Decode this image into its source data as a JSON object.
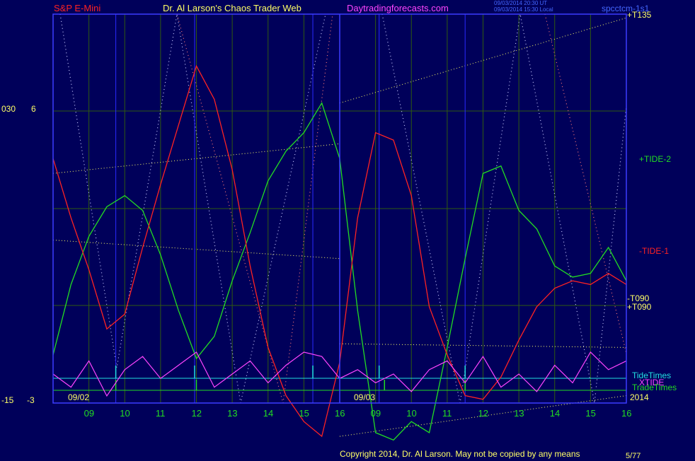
{
  "header": {
    "symbol": "S&P E-Mini",
    "title": "Dr. Al Larson's Chaos Trader Web",
    "site": "Daytradingforecasts.com",
    "time_line1": "09/03/2014 20:30 UT",
    "time_line2": "09/03/2014 15:30 Local",
    "file": "spcctcm-1s1"
  },
  "left_axis": {
    "top_a": "030",
    "top_b": "6",
    "bottom_a": "-15",
    "bottom_b": "-3"
  },
  "dates": {
    "day1": "09/02",
    "day2": "09/03",
    "year": "2014"
  },
  "copyright": "Copyright 2014, Dr. Al Larson. May not be copied by any means",
  "corner_code": "5/77",
  "colors": {
    "background": "#00005a",
    "frame": "#3c3cff",
    "grid": "#2f5a10",
    "tide2": "#22dd22",
    "tide1": "#ff2222",
    "xtide": "#ff44ff",
    "tide_times": "#22e0e0",
    "trade_times": "#22dd22",
    "yellow": "#ffff66",
    "pink": "#ff44ff",
    "blue_text": "#4466ff"
  },
  "chart_data": {
    "type": "line",
    "title": "Dr. Al Larson's Chaos Trader Web",
    "instrument": "S&P E-Mini",
    "x_ticks": [
      "09",
      "10",
      "11",
      "12",
      "13",
      "14",
      "15",
      "16",
      "09",
      "10",
      "11",
      "12",
      "13",
      "14",
      "15",
      "16"
    ],
    "x": [
      8.0,
      8.5,
      9.0,
      9.5,
      10.0,
      10.5,
      11.0,
      11.5,
      12.0,
      12.5,
      13.0,
      13.5,
      14.0,
      14.5,
      15.0,
      15.5,
      16.0,
      16.5,
      17.0,
      17.5,
      18.0,
      18.5,
      19.0,
      19.5,
      20.0,
      20.5,
      21.0,
      21.5,
      22.0,
      22.5,
      23.0,
      23.5,
      24.0
    ],
    "series": [
      {
        "name": "+TIDE-2",
        "values": [
          -1.7,
          0.2,
          1.5,
          2.3,
          2.6,
          2.2,
          1.0,
          -0.5,
          -1.8,
          -1.2,
          0.3,
          1.6,
          3.0,
          3.8,
          4.3,
          5.1,
          3.6,
          -0.5,
          -3.8,
          -4.0,
          -3.5,
          -3.8,
          -1.5,
          0.9,
          3.2,
          3.4,
          2.2,
          1.7,
          0.7,
          0.4,
          0.5,
          1.2,
          0.3
        ]
      },
      {
        "name": "-TIDE-1",
        "values": [
          3.6,
          2.0,
          0.6,
          -1.0,
          -0.6,
          1.2,
          2.9,
          4.5,
          6.1,
          5.2,
          3.3,
          0.7,
          -1.5,
          -2.8,
          -3.5,
          -3.9,
          -1.9,
          2.0,
          4.3,
          4.1,
          2.6,
          -0.4,
          -1.7,
          -2.8,
          -2.9,
          -2.3,
          -1.3,
          -0.4,
          0.1,
          0.3,
          0.2,
          0.5,
          0.2
        ]
      }
    ],
    "oscillator": {
      "name": "XTIDE",
      "values": [
        0.5,
        0.2,
        0.8,
        0.0,
        0.6,
        0.9,
        0.4,
        0.7,
        1.0,
        0.2,
        0.5,
        0.8,
        0.3,
        0.7,
        1.0,
        0.9,
        0.4,
        0.6,
        0.3,
        0.5,
        0.1,
        0.6,
        0.8,
        0.3,
        0.9,
        0.2,
        0.5,
        0.1,
        0.7,
        0.3,
        1.0,
        0.6,
        0.8
      ]
    },
    "bands": [
      {
        "label": "+T135",
        "day": 2,
        "values": [
          5.1,
          7.4
        ]
      },
      {
        "label": "",
        "day": 1,
        "values": [
          3.2,
          4.0
        ]
      },
      {
        "label": "",
        "day": 1,
        "values": [
          1.4,
          0.9
        ]
      },
      {
        "label": "-T090",
        "day": 2,
        "values": [
          -1.4,
          -1.5
        ]
      },
      {
        "label": "+T090",
        "day": 2,
        "values": [
          -3.9,
          -2.8
        ]
      }
    ],
    "tide_times": [
      9.75,
      11.95,
      15.25,
      17.1,
      19.5
    ],
    "trade_times": [
      9.75,
      12.0,
      17.25,
      19.5
    ],
    "labels": [
      "+TIDE-2",
      "-TIDE-1",
      "TideTimes",
      "XTIDE",
      "TradeTimes",
      "+T135",
      "-T090",
      "+T090"
    ],
    "x_range": [
      8.0,
      24.0
    ],
    "y_range": [
      -3,
      7.5
    ],
    "day_split": 16.0,
    "grid": true
  }
}
